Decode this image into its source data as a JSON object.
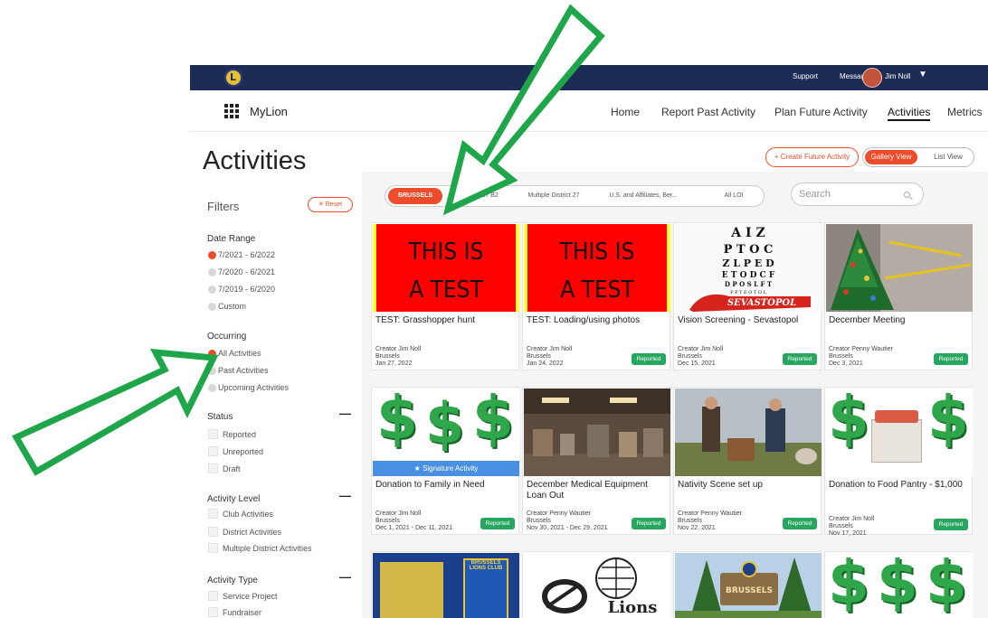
{
  "topbar": {
    "support": "Support",
    "messages": "Messages",
    "user": "Jim Noll"
  },
  "nav": {
    "brand": "MyLion",
    "links": [
      "Home",
      "Report Past Activity",
      "Plan Future Activity",
      "Activities",
      "Metrics"
    ]
  },
  "page": {
    "title": "Activities",
    "create_button": "+ Create Future Activity",
    "gallery_view": "Gallery View",
    "list_view": "List View"
  },
  "filters": {
    "title": "Filters",
    "reset": "Reset",
    "date_range": {
      "label": "Date Range",
      "options": [
        "7/2021 - 6/2022",
        "7/2020 - 6/2021",
        "7/2019 - 6/2020",
        "Custom"
      ]
    },
    "occurring": {
      "label": "Occurring",
      "options": [
        "All Activities",
        "Past Activities",
        "Upcoming Activities"
      ]
    },
    "status": {
      "label": "Status",
      "options": [
        "Reported",
        "Unreported",
        "Draft"
      ]
    },
    "activity_level": {
      "label": "Activity Level",
      "options": [
        "Club Activities",
        "District Activities",
        "Multiple District Activities"
      ]
    },
    "activity_type": {
      "label": "Activity Type",
      "options": [
        "Service Project",
        "Fundraiser"
      ]
    }
  },
  "location_tabs": [
    "BRUSSELS",
    "District 27 B2",
    "Multiple District 27",
    "U.S. and Affiliates, Ber...",
    "All LOI"
  ],
  "search": {
    "placeholder": "Search"
  },
  "cards": [
    {
      "title": "TEST: Grasshopper hunt",
      "creator": "Creator Jim Noll",
      "club": "Brussels",
      "date": "Jan 27, 2022",
      "badge": "",
      "image_text": [
        "THIS IS",
        "A TEST"
      ]
    },
    {
      "title": "TEST: Loading/using photos",
      "creator": "Creator Jim Noll",
      "club": "Brussels",
      "date": "Jan 24, 2022",
      "badge": "Reported",
      "image_text": [
        "THIS IS",
        "A TEST"
      ]
    },
    {
      "title": "Vision Screening - Sevastopol",
      "creator": "Creator Jim Noll",
      "club": "Brussels",
      "date": "Dec 15, 2021",
      "badge": "Reported",
      "image_text": [
        "SEVASTOPOL"
      ]
    },
    {
      "title": "December Meeting",
      "creator": "Creator Penny Wautier",
      "club": "Brussels",
      "date": "Dec 3, 2021",
      "badge": "Reported"
    },
    {
      "title": "Donation to Family in Need",
      "creator": "Creator Jim Noll",
      "club": "Brussels",
      "date": "Dec 1, 2021 - Dec 11, 2021",
      "badge": "Reported",
      "banner": "Signature Activity"
    },
    {
      "title": "December Medical Equipment Loan Out",
      "creator": "Creator Penny Wautier",
      "club": "Brussels",
      "date": "Nov 30, 2021 - Dec 29, 2021",
      "badge": "Reported"
    },
    {
      "title": "Nativity Scene set up",
      "creator": "Creator Penny Wautier",
      "club": "Brussels",
      "date": "Nov 22, 2021",
      "badge": "Reported"
    },
    {
      "title": "Donation to Food Pantry - $1,000",
      "creator": "Creator Jim Noll",
      "club": "Brussels",
      "date": "Nov 17, 2021",
      "badge": "Reported"
    }
  ],
  "partial_cards": {
    "lions_club_banner": "BRUSSELS LIONS CLUB",
    "recycle_text": "Lions",
    "park_sign": "BRUSSELS"
  },
  "colors": {
    "brand_navy": "#1d2c55",
    "accent": "#ee4c2b",
    "reported_green": "#27a660",
    "arrow_green": "#1fa64a"
  }
}
